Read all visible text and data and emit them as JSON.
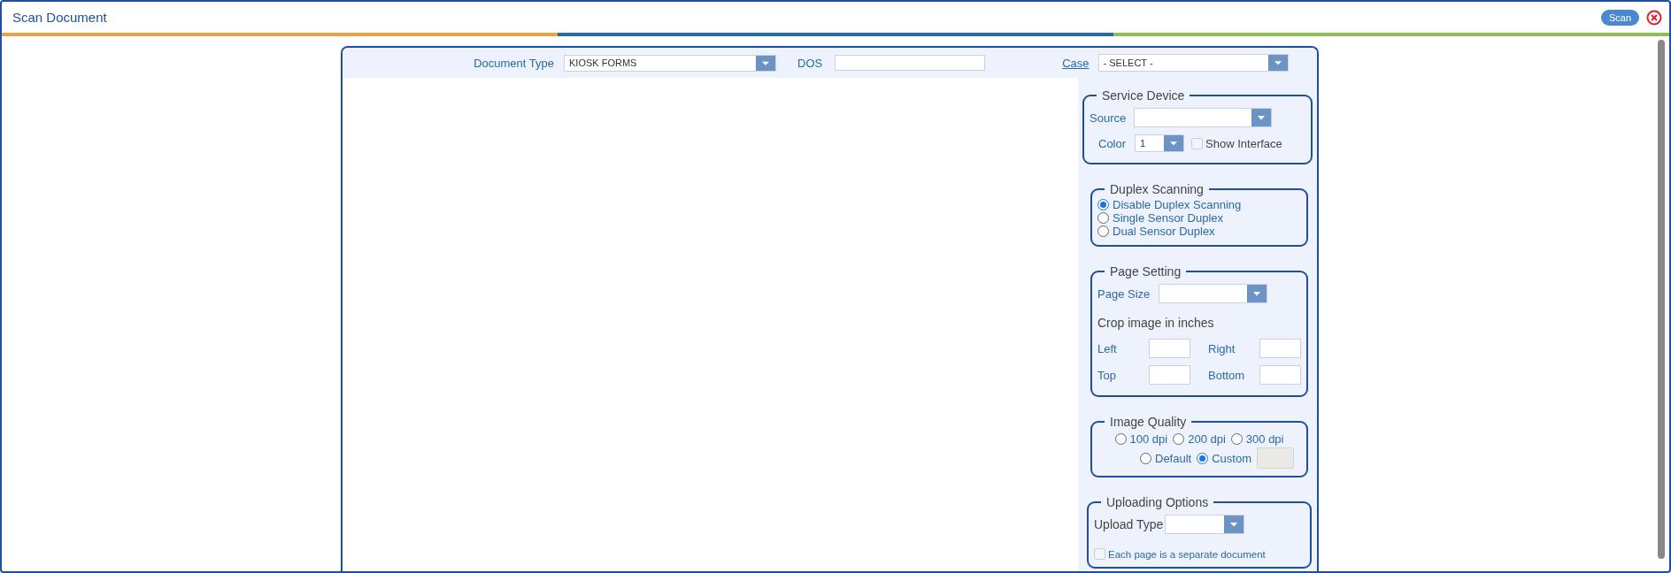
{
  "window": {
    "title": "Scan Document",
    "scan_button": "Scan"
  },
  "header": {
    "document_type": {
      "label": "Document Type",
      "value": "KIOSK FORMS"
    },
    "dos": {
      "label": "DOS"
    },
    "case": {
      "label": "Case",
      "value": "- SELECT -"
    }
  },
  "service_device": {
    "title": "Service Device",
    "source_label": "Source",
    "color_label": "Color",
    "color_value": "1",
    "show_interface": {
      "label": "Show Interface",
      "checked": false
    }
  },
  "duplex_scanning": {
    "title": "Duplex Scanning",
    "options": [
      {
        "label": "Disable Duplex Scanning",
        "selected": true
      },
      {
        "label": "Single Sensor Duplex",
        "selected": false
      },
      {
        "label": "Dual Sensor Duplex",
        "selected": false
      }
    ]
  },
  "page_setting": {
    "title": "Page Setting",
    "page_size_label": "Page Size",
    "crop_caption": "Crop image in inches",
    "crop_fields": [
      {
        "label": "Left"
      },
      {
        "label": "Right"
      },
      {
        "label": "Top"
      },
      {
        "label": "Bottom"
      }
    ]
  },
  "image_quality": {
    "title": "Image Quality",
    "options": [
      {
        "label": "100 dpi",
        "selected": false
      },
      {
        "label": "200 dpi",
        "selected": false
      },
      {
        "label": "300 dpi",
        "selected": false
      },
      {
        "label": "Default",
        "selected": false
      },
      {
        "label": "Custom",
        "selected": true
      }
    ]
  },
  "uploading_options": {
    "title": "Uploading Options",
    "upload_type_label": "Upload Type",
    "separate_document": {
      "label": "Each page is a separate document",
      "checked": false
    }
  }
}
